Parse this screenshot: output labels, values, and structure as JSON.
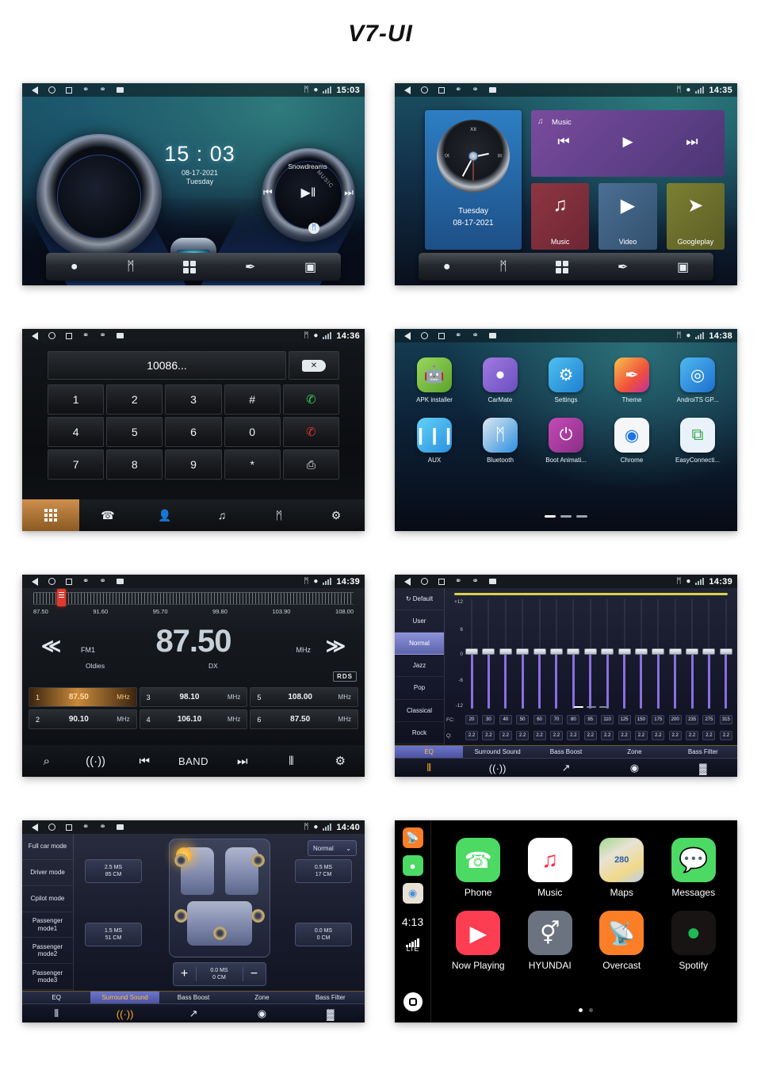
{
  "page": {
    "title": "V7-UI"
  },
  "statusbar": {
    "nav": [
      "back-icon",
      "home-icon",
      "recents-icon",
      "usb-icon",
      "usb-icon",
      "sdcard-icon"
    ],
    "right_icons": [
      "bluetooth-icon",
      "location-icon",
      "signal-icon"
    ]
  },
  "screens": {
    "home_dial": {
      "time": "15:03",
      "clock_time": "15 : 03",
      "date": "08-17-2021",
      "weekday": "Tuesday",
      "song": "Snowdreams",
      "music_word": "MUSIC",
      "controls": {
        "prev": "⏮",
        "play_pause": "▶‖",
        "next": "⏭"
      },
      "dock": [
        "navigation-icon",
        "bluetooth-icon",
        "apps-icon",
        "theme-icon",
        "radio-icon"
      ]
    },
    "home_widget": {
      "time": "14:35",
      "weekday": "Tuesday",
      "date": "08-17-2021",
      "romans": {
        "twelve": "XII",
        "three": "III",
        "nine": "IX"
      },
      "music_panel": {
        "title": "Music",
        "prev": "⏮",
        "play": "▶",
        "next": "⏭"
      },
      "tiles": [
        {
          "label": "Music",
          "glyph": "♫"
        },
        {
          "label": "Video",
          "glyph": "▶"
        },
        {
          "label": "Googleplay",
          "glyph": "➤"
        }
      ],
      "dock": [
        "navigation-icon",
        "bluetooth-icon",
        "apps-icon",
        "theme-icon",
        "radio-icon"
      ]
    },
    "dialer": {
      "time": "14:36",
      "number": "10086...",
      "delete_label": "✕",
      "keys": [
        "1",
        "2",
        "3",
        "#",
        "call",
        "4",
        "5",
        "6",
        "0",
        "hangup",
        "7",
        "8",
        "9",
        "*",
        "transfer"
      ],
      "call_glyph": "✆",
      "hangup_glyph": "✆",
      "transfer_glyph": "⎙",
      "tabs": [
        "keypad-icon",
        "call-log-icon",
        "contacts-icon",
        "bt-audio-icon",
        "phone-bt-icon",
        "settings-icon"
      ],
      "tab_glyphs": [
        "",
        "✆",
        "☎",
        "♫",
        "⎓",
        "⚙"
      ]
    },
    "apps": {
      "time": "14:38",
      "row1": [
        {
          "label": "APK installer",
          "glyph": "●",
          "color": "#7cc242"
        },
        {
          "label": "CarMate",
          "glyph": "M",
          "color": "#8a6fd4"
        },
        {
          "label": "Settings",
          "glyph": "⚙",
          "color": "#2f9fe0"
        },
        {
          "label": "Theme",
          "glyph": "✎",
          "color": "#f0603c"
        },
        {
          "label": "AndroiTS GP...",
          "glyph": "◎",
          "color": "#2f8fe0"
        }
      ],
      "row2": [
        {
          "label": "AUX",
          "glyph": "‖",
          "color": "#3fa9e8"
        },
        {
          "label": "Bluetooth",
          "glyph": "ᛗ",
          "color": "#1e86d8"
        },
        {
          "label": "Boot Animati...",
          "glyph": "⏻",
          "color": "#b5359a"
        },
        {
          "label": "Chrome",
          "glyph": "◉",
          "color": "#f1f3f4"
        },
        {
          "label": "EasyConnecti...",
          "glyph": "⧉",
          "color": "#e8f1fb"
        }
      ],
      "page_dots": 3,
      "active_dot": 0
    },
    "radio": {
      "time": "14:39",
      "scale_labels": [
        "87.50",
        "91.60",
        "95.70",
        "99.80",
        "103.90",
        "108.00"
      ],
      "frequency": "87.50",
      "unit": "MHz",
      "band": "FM1",
      "genre": "Oldies",
      "sensitivity": "DX",
      "rds": "RDS",
      "prev_glyph": "≪",
      "next_glyph": "≫",
      "presets": [
        {
          "no": "1",
          "freq": "87.50",
          "unit": "MHz",
          "active": true
        },
        {
          "no": "2",
          "freq": "90.10",
          "unit": "MHz",
          "active": false
        },
        {
          "no": "3",
          "freq": "98.10",
          "unit": "MHz",
          "active": false
        },
        {
          "no": "4",
          "freq": "106.10",
          "unit": "MHz",
          "active": false
        },
        {
          "no": "5",
          "freq": "108.00",
          "unit": "MHz",
          "active": false
        },
        {
          "no": "6",
          "freq": "87.50",
          "unit": "MHz",
          "active": false
        }
      ],
      "tabs": [
        {
          "name": "search-icon",
          "glyph": "⌕"
        },
        {
          "name": "scan-icon",
          "glyph": "((·))"
        },
        {
          "name": "prev-station-icon",
          "glyph": "⏮"
        },
        {
          "name": "band-button",
          "glyph": "BAND"
        },
        {
          "name": "next-station-icon",
          "glyph": "⏭"
        },
        {
          "name": "equalizer-icon",
          "glyph": "⫴"
        },
        {
          "name": "settings-icon",
          "glyph": "⚙"
        }
      ]
    },
    "equalizer": {
      "time": "14:39",
      "presets": [
        "Default",
        "User",
        "Normal",
        "Jazz",
        "Pop",
        "Classical",
        "Rock"
      ],
      "selected_preset": "Normal",
      "default_icon": "refresh-icon",
      "axis_labels": [
        "+12",
        "6",
        "0",
        "-6",
        "-12"
      ],
      "fc_label": "FC:",
      "q_label": "Q:",
      "page_dots": 3,
      "active_dot": 0,
      "tabs": [
        {
          "label": "EQ",
          "glyph": "⫴",
          "active": true
        },
        {
          "label": "Surround Sound",
          "glyph": "((·))",
          "active": false
        },
        {
          "label": "Bass Boost",
          "glyph": "↗",
          "active": false
        },
        {
          "label": "Zone",
          "glyph": "◉",
          "active": false
        },
        {
          "label": "Bass Filter",
          "glyph": "▓",
          "active": false
        }
      ]
    },
    "surround": {
      "time": "14:40",
      "modes": [
        "Full car mode",
        "Driver mode",
        "Cpilot mode",
        "Passenger mode1",
        "Passenger mode2",
        "Passenger mode3"
      ],
      "mode_select": "Normal",
      "delays": [
        {
          "ms": "2.5 MS",
          "cm": "85 CM"
        },
        {
          "ms": "0.5 MS",
          "cm": "17 CM"
        },
        {
          "ms": "1.5 MS",
          "cm": "51 CM"
        },
        {
          "ms": "0.0 MS",
          "cm": "0 CM"
        }
      ],
      "stepper": {
        "plus": "+",
        "minus": "−",
        "ms": "0.0 MS",
        "cm": "0 CM"
      },
      "tabs": [
        {
          "label": "EQ",
          "glyph": "⫴",
          "active": false
        },
        {
          "label": "Surround Sound",
          "glyph": "((·))",
          "active": true
        },
        {
          "label": "Bass Boost",
          "glyph": "↗",
          "active": false
        },
        {
          "label": "Zone",
          "glyph": "◉",
          "active": false
        },
        {
          "label": "Bass Filter",
          "glyph": "▓",
          "active": false
        }
      ]
    },
    "carplay": {
      "time": "4:13",
      "network": "LTE",
      "sidebar_apps": [
        "overcast-icon",
        "messages-icon",
        "maps-icon"
      ],
      "row1": [
        {
          "label": "Phone",
          "glyph": "✆",
          "color": "#4cd964"
        },
        {
          "label": "Music",
          "glyph": "♫",
          "color": "#ffffff"
        },
        {
          "label": "Maps",
          "glyph": "280",
          "color": "#e8e2d5"
        },
        {
          "label": "Messages",
          "glyph": "●",
          "color": "#4cd964"
        }
      ],
      "row2": [
        {
          "label": "Now Playing",
          "glyph": "▶",
          "color": "#fc3d52"
        },
        {
          "label": "HYUNDAI",
          "glyph": "Ⓗ",
          "color": "#6b7280"
        },
        {
          "label": "Overcast",
          "glyph": "▲",
          "color": "#fc7e26"
        },
        {
          "label": "Spotify",
          "glyph": "≡",
          "color": "#191414"
        }
      ],
      "page_dots": 2,
      "active_dot": 0
    }
  },
  "eq_data": {
    "fc": [
      "20",
      "30",
      "40",
      "50",
      "60",
      "70",
      "80",
      "95",
      "110",
      "125",
      "150",
      "175",
      "200",
      "235",
      "275",
      "315"
    ],
    "q": [
      "2.2",
      "2.2",
      "2.2",
      "2.2",
      "2.2",
      "2.2",
      "2.2",
      "2.2",
      "2.2",
      "2.2",
      "2.2",
      "2.2",
      "2.2",
      "2.2",
      "2.2",
      "2.2"
    ],
    "gains": [
      0,
      0,
      0,
      0,
      0,
      0,
      0,
      0,
      0,
      0,
      0,
      0,
      0,
      0,
      0,
      0
    ]
  }
}
